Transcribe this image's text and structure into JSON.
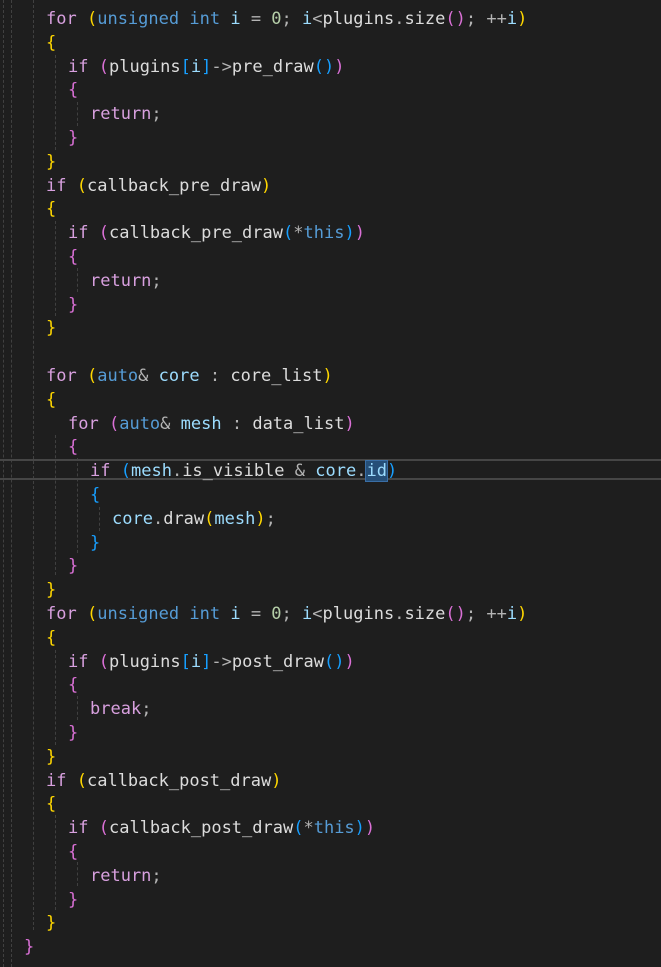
{
  "editor": {
    "colors": {
      "background": "#1e1e1e",
      "keyword": "#569cd6",
      "control_keyword": "#d8a0df",
      "identifier": "#dcdcdc",
      "variable": "#9cdcfe",
      "number": "#b5cea8",
      "bracket_gold": "#ffd700",
      "bracket_orchid": "#da70d6",
      "bracket_blue": "#179fff",
      "selection": "#264f78"
    },
    "lines": [
      {
        "indent": 1,
        "tokens": [
          [
            "for",
            "ctrl"
          ],
          [
            " ",
            "id"
          ],
          [
            "(",
            "b1"
          ],
          [
            "unsigned",
            "kw"
          ],
          [
            " ",
            "id"
          ],
          [
            "int",
            "kw"
          ],
          [
            " ",
            "id"
          ],
          [
            "i",
            "var"
          ],
          [
            " = ",
            "op"
          ],
          [
            "0",
            "num"
          ],
          [
            "; ",
            "op"
          ],
          [
            "i",
            "var"
          ],
          [
            "<",
            "op"
          ],
          [
            "plugins",
            "id"
          ],
          [
            ".",
            "op"
          ],
          [
            "size",
            "id"
          ],
          [
            "()",
            "b2"
          ],
          [
            "; ",
            "op"
          ],
          [
            "++",
            "op"
          ],
          [
            "i",
            "var"
          ],
          [
            ")",
            "b1"
          ]
        ]
      },
      {
        "indent": 1,
        "tokens": [
          [
            "{",
            "b1"
          ]
        ]
      },
      {
        "indent": 2,
        "tokens": [
          [
            "if",
            "ctrl"
          ],
          [
            " ",
            "id"
          ],
          [
            "(",
            "b2"
          ],
          [
            "plugins",
            "id"
          ],
          [
            "[",
            "b3"
          ],
          [
            "i",
            "var"
          ],
          [
            "]",
            "b3"
          ],
          [
            "->",
            "op"
          ],
          [
            "pre_draw",
            "id"
          ],
          [
            "()",
            "b3"
          ],
          [
            ")",
            "b2"
          ]
        ]
      },
      {
        "indent": 2,
        "tokens": [
          [
            "{",
            "b2"
          ]
        ]
      },
      {
        "indent": 3,
        "tokens": [
          [
            "return",
            "ctrl"
          ],
          [
            ";",
            "op"
          ]
        ]
      },
      {
        "indent": 2,
        "tokens": [
          [
            "}",
            "b2"
          ]
        ]
      },
      {
        "indent": 1,
        "tokens": [
          [
            "}",
            "b1"
          ]
        ]
      },
      {
        "indent": 1,
        "tokens": [
          [
            "if",
            "ctrl"
          ],
          [
            " ",
            "id"
          ],
          [
            "(",
            "b1"
          ],
          [
            "callback_pre_draw",
            "id"
          ],
          [
            ")",
            "b1"
          ]
        ]
      },
      {
        "indent": 1,
        "tokens": [
          [
            "{",
            "b1"
          ]
        ]
      },
      {
        "indent": 2,
        "tokens": [
          [
            "if",
            "ctrl"
          ],
          [
            " ",
            "id"
          ],
          [
            "(",
            "b2"
          ],
          [
            "callback_pre_draw",
            "id"
          ],
          [
            "(",
            "b3"
          ],
          [
            "*",
            "op"
          ],
          [
            "this",
            "kw"
          ],
          [
            ")",
            "b3"
          ],
          [
            ")",
            "b2"
          ]
        ]
      },
      {
        "indent": 2,
        "tokens": [
          [
            "{",
            "b2"
          ]
        ]
      },
      {
        "indent": 3,
        "tokens": [
          [
            "return",
            "ctrl"
          ],
          [
            ";",
            "op"
          ]
        ]
      },
      {
        "indent": 2,
        "tokens": [
          [
            "}",
            "b2"
          ]
        ]
      },
      {
        "indent": 1,
        "tokens": [
          [
            "}",
            "b1"
          ]
        ]
      },
      {
        "indent": 0,
        "tokens": []
      },
      {
        "indent": 1,
        "tokens": [
          [
            "for",
            "ctrl"
          ],
          [
            " ",
            "id"
          ],
          [
            "(",
            "b1"
          ],
          [
            "auto",
            "kw"
          ],
          [
            "& ",
            "op"
          ],
          [
            "core",
            "var"
          ],
          [
            " : ",
            "op"
          ],
          [
            "core_list",
            "id"
          ],
          [
            ")",
            "b1"
          ]
        ]
      },
      {
        "indent": 1,
        "tokens": [
          [
            "{",
            "b1"
          ]
        ]
      },
      {
        "indent": 2,
        "tokens": [
          [
            "for",
            "ctrl"
          ],
          [
            " ",
            "id"
          ],
          [
            "(",
            "b2"
          ],
          [
            "auto",
            "kw"
          ],
          [
            "& ",
            "op"
          ],
          [
            "mesh",
            "var"
          ],
          [
            " : ",
            "op"
          ],
          [
            "data_list",
            "id"
          ],
          [
            ")",
            "b2"
          ]
        ]
      },
      {
        "indent": 2,
        "tokens": [
          [
            "{",
            "b2"
          ]
        ]
      },
      {
        "indent": 3,
        "tokens": [
          [
            "if",
            "ctrl"
          ],
          [
            " ",
            "id"
          ],
          [
            "(",
            "b3"
          ],
          [
            "mesh",
            "var"
          ],
          [
            ".",
            "op"
          ],
          [
            "is_visible",
            "id"
          ],
          [
            " & ",
            "op"
          ],
          [
            "core",
            "var"
          ],
          [
            ".",
            "op"
          ],
          [
            "id",
            "var"
          ],
          [
            ")",
            "b3"
          ]
        ]
      },
      {
        "indent": 3,
        "tokens": [
          [
            "{",
            "b3"
          ]
        ]
      },
      {
        "indent": 4,
        "tokens": [
          [
            "core",
            "var"
          ],
          [
            ".",
            "op"
          ],
          [
            "draw",
            "id"
          ],
          [
            "(",
            "b1"
          ],
          [
            "mesh",
            "var"
          ],
          [
            ")",
            "b1"
          ],
          [
            ";",
            "op"
          ]
        ]
      },
      {
        "indent": 3,
        "tokens": [
          [
            "}",
            "b3"
          ]
        ]
      },
      {
        "indent": 2,
        "tokens": [
          [
            "}",
            "b2"
          ]
        ]
      },
      {
        "indent": 1,
        "tokens": [
          [
            "}",
            "b1"
          ]
        ]
      },
      {
        "indent": 1,
        "tokens": [
          [
            "for",
            "ctrl"
          ],
          [
            " ",
            "id"
          ],
          [
            "(",
            "b1"
          ],
          [
            "unsigned",
            "kw"
          ],
          [
            " ",
            "id"
          ],
          [
            "int",
            "kw"
          ],
          [
            " ",
            "id"
          ],
          [
            "i",
            "var"
          ],
          [
            " = ",
            "op"
          ],
          [
            "0",
            "num"
          ],
          [
            "; ",
            "op"
          ],
          [
            "i",
            "var"
          ],
          [
            "<",
            "op"
          ],
          [
            "plugins",
            "id"
          ],
          [
            ".",
            "op"
          ],
          [
            "size",
            "id"
          ],
          [
            "()",
            "b2"
          ],
          [
            "; ",
            "op"
          ],
          [
            "++",
            "op"
          ],
          [
            "i",
            "var"
          ],
          [
            ")",
            "b1"
          ]
        ]
      },
      {
        "indent": 1,
        "tokens": [
          [
            "{",
            "b1"
          ]
        ]
      },
      {
        "indent": 2,
        "tokens": [
          [
            "if",
            "ctrl"
          ],
          [
            " ",
            "id"
          ],
          [
            "(",
            "b2"
          ],
          [
            "plugins",
            "id"
          ],
          [
            "[",
            "b3"
          ],
          [
            "i",
            "var"
          ],
          [
            "]",
            "b3"
          ],
          [
            "->",
            "op"
          ],
          [
            "post_draw",
            "id"
          ],
          [
            "()",
            "b3"
          ],
          [
            ")",
            "b2"
          ]
        ]
      },
      {
        "indent": 2,
        "tokens": [
          [
            "{",
            "b2"
          ]
        ]
      },
      {
        "indent": 3,
        "tokens": [
          [
            "break",
            "ctrl"
          ],
          [
            ";",
            "op"
          ]
        ]
      },
      {
        "indent": 2,
        "tokens": [
          [
            "}",
            "b2"
          ]
        ]
      },
      {
        "indent": 1,
        "tokens": [
          [
            "}",
            "b1"
          ]
        ]
      },
      {
        "indent": 1,
        "tokens": [
          [
            "if",
            "ctrl"
          ],
          [
            " ",
            "id"
          ],
          [
            "(",
            "b1"
          ],
          [
            "callback_post_draw",
            "id"
          ],
          [
            ")",
            "b1"
          ]
        ]
      },
      {
        "indent": 1,
        "tokens": [
          [
            "{",
            "b1"
          ]
        ]
      },
      {
        "indent": 2,
        "tokens": [
          [
            "if",
            "ctrl"
          ],
          [
            " ",
            "id"
          ],
          [
            "(",
            "b2"
          ],
          [
            "callback_post_draw",
            "id"
          ],
          [
            "(",
            "b3"
          ],
          [
            "*",
            "op"
          ],
          [
            "this",
            "kw"
          ],
          [
            ")",
            "b3"
          ],
          [
            ")",
            "b2"
          ]
        ]
      },
      {
        "indent": 2,
        "tokens": [
          [
            "{",
            "b2"
          ]
        ]
      },
      {
        "indent": 3,
        "tokens": [
          [
            "return",
            "ctrl"
          ],
          [
            ";",
            "op"
          ]
        ]
      },
      {
        "indent": 2,
        "tokens": [
          [
            "}",
            "b2"
          ]
        ]
      },
      {
        "indent": 1,
        "tokens": [
          [
            "}",
            "b1"
          ]
        ]
      },
      {
        "indent": 0,
        "tokens": [
          [
            "}",
            "b2"
          ]
        ]
      }
    ],
    "current_line": 19,
    "selection": {
      "line": 19,
      "token": 9
    }
  }
}
